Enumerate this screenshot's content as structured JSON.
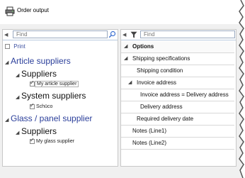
{
  "window": {
    "title": "Order output"
  },
  "left": {
    "search_placeholder": "Find",
    "print_label": "Print",
    "tree": [
      {
        "label": "Article suppliers",
        "child_label": "Suppliers",
        "item": "My article supplier",
        "sub_label": "System suppliers",
        "sub_item": "Schüco"
      },
      {
        "label": "Glass / panel supplier",
        "child_label": "Suppliers",
        "item": "My glass supplier"
      }
    ]
  },
  "right": {
    "search_placeholder": "Find",
    "options": [
      "Options",
      "Shipping specifications",
      "Shipping condition",
      "Invoice address",
      "Invoice address = Delivery address",
      "Delivery address",
      "Required delivery date",
      "Notes (Line1)",
      "Notes (Line2)"
    ]
  },
  "icons": {
    "title": "printer-icon",
    "search": "magnifier-icon",
    "filter": "funnel-icon"
  },
  "colors": {
    "tree_group": "#2a3e9a",
    "panel_border": "#c8c8c8",
    "background": "#f0f0f0"
  }
}
